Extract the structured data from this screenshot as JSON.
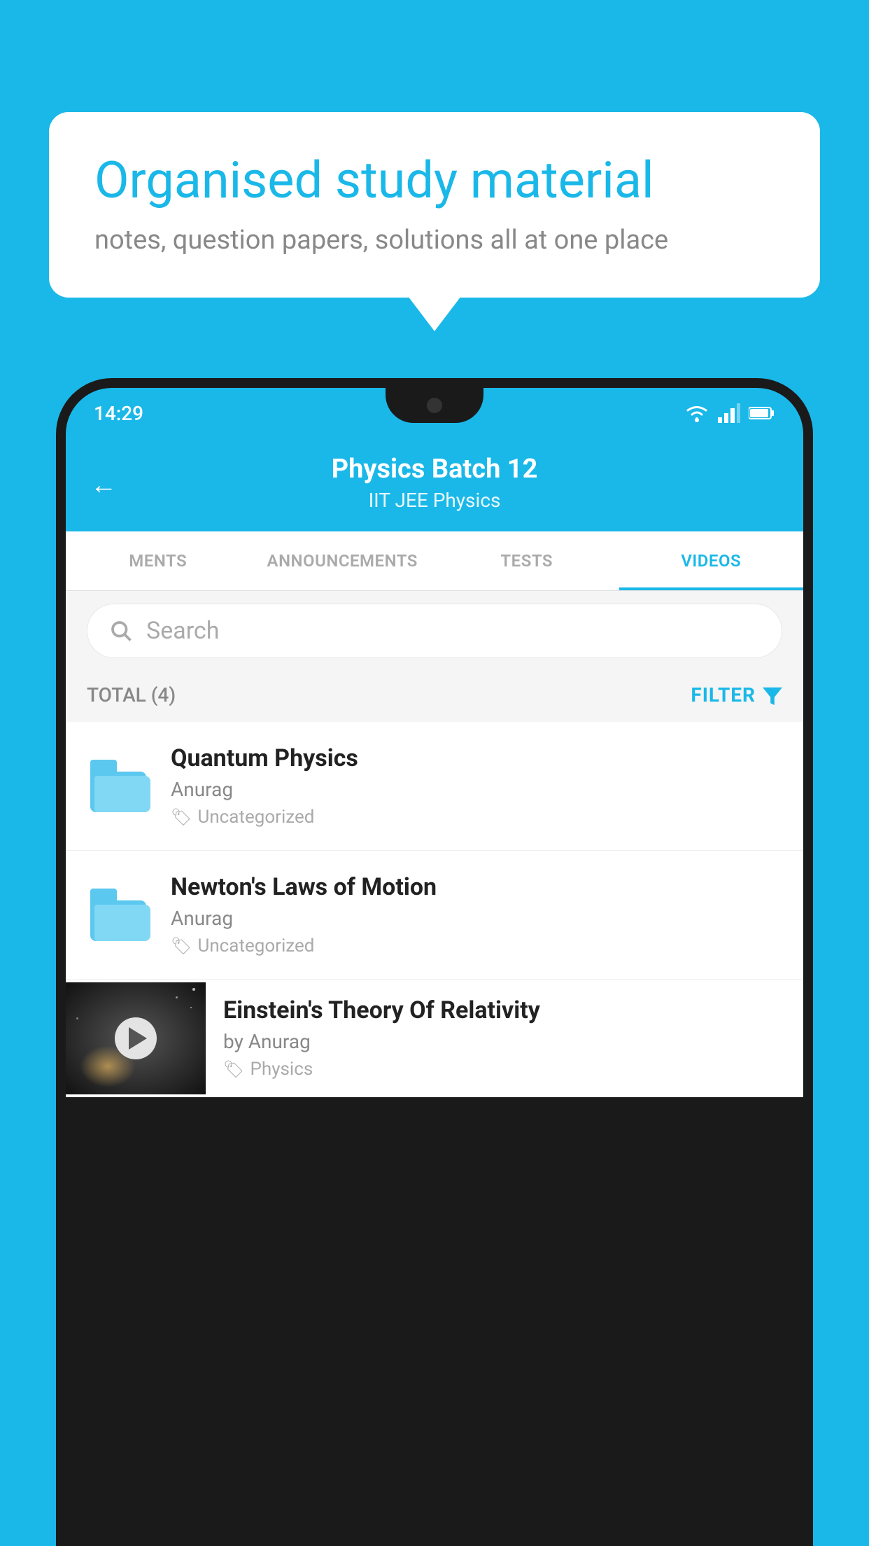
{
  "background_color": "#1ab8e8",
  "bubble": {
    "title": "Organised study material",
    "subtitle": "notes, question papers, solutions all at one place"
  },
  "status_bar": {
    "time": "14:29",
    "icons": [
      "wifi",
      "signal",
      "battery"
    ]
  },
  "header": {
    "title": "Physics Batch 12",
    "subtitle": "IIT JEE   Physics",
    "back_label": "←"
  },
  "tabs": [
    {
      "label": "MENTS",
      "active": false
    },
    {
      "label": "ANNOUNCEMENTS",
      "active": false
    },
    {
      "label": "TESTS",
      "active": false
    },
    {
      "label": "VIDEOS",
      "active": true
    }
  ],
  "search": {
    "placeholder": "Search"
  },
  "filter_bar": {
    "total_label": "TOTAL (4)",
    "filter_label": "FILTER"
  },
  "items": [
    {
      "type": "folder",
      "title": "Quantum Physics",
      "author": "Anurag",
      "tag": "Uncategorized"
    },
    {
      "type": "folder",
      "title": "Newton's Laws of Motion",
      "author": "Anurag",
      "tag": "Uncategorized"
    },
    {
      "type": "video",
      "title": "Einstein's Theory Of Relativity",
      "author": "by Anurag",
      "tag": "Physics"
    }
  ]
}
